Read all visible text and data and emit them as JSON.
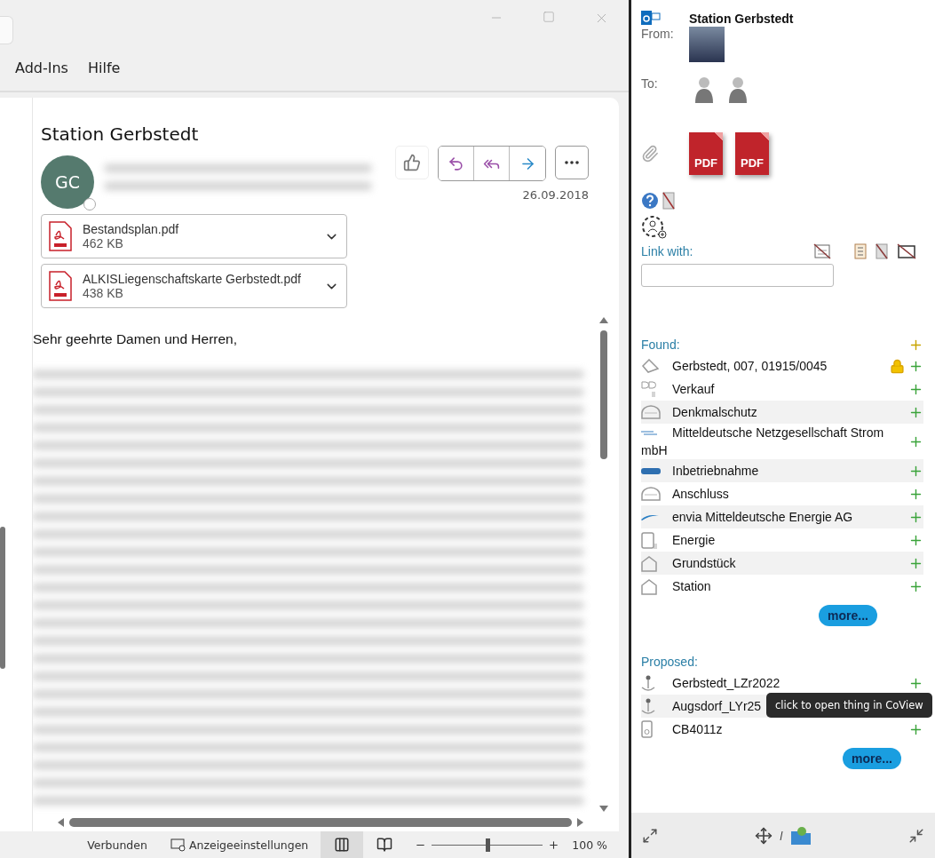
{
  "menu": [
    "Add-Ins",
    "Hilfe"
  ],
  "message": {
    "subject": "Station Gerbstedt",
    "avatar_initials": "GC",
    "date": "26.09.2018",
    "attachments": [
      {
        "name": "Bestandsplan.pdf",
        "size": "462 KB"
      },
      {
        "name": "ALKISLiegenschaftskarte Gerbstedt.pdf",
        "size": "438 KB"
      }
    ],
    "greeting": "Sehr geehrte Damen und Herren,"
  },
  "status_bar": {
    "connection": "Verbunden",
    "display_settings": "Anzeigeeinstellungen",
    "views": [
      {
        "kind": "normal",
        "selected": true
      },
      {
        "kind": "reading",
        "selected": false
      }
    ],
    "zoom": {
      "level": 0.5,
      "reading": "100 %"
    }
  },
  "panel": {
    "subject": "Station Gerbstedt",
    "from_label": "From:",
    "to_label": "To:",
    "attachment_icons": [
      "PDF",
      "PDF"
    ],
    "link_label": "Link with:",
    "found_label": "Found:",
    "found_more": "more...",
    "proposed_label": "Proposed:",
    "proposed_more": "more...",
    "found": [
      {
        "kind": "parcel",
        "label": "Gerbstedt, 007, 01915/0045",
        "locked": true,
        "shaded": false
      },
      {
        "kind": "sale",
        "label": "Verkauf",
        "locked": false,
        "shaded": false
      },
      {
        "kind": "arch",
        "label": "Denkmalschutz",
        "locked": false,
        "shaded": true
      },
      {
        "kind": "logo",
        "label": "Mitteldeutsche Netzgesellschaft Strom mbH",
        "locked": false,
        "shaded": false
      },
      {
        "kind": "tag",
        "label": "Inbetriebnahme",
        "locked": false,
        "shaded": true
      },
      {
        "kind": "arch",
        "label": "Anschluss",
        "locked": false,
        "shaded": false
      },
      {
        "kind": "swoosh",
        "label": "envia Mitteldeutsche Energie AG",
        "locked": false,
        "shaded": true
      },
      {
        "kind": "doc",
        "label": "Energie",
        "locked": false,
        "shaded": false
      },
      {
        "kind": "house",
        "label": "Grundstück",
        "locked": false,
        "shaded": true
      },
      {
        "kind": "house",
        "label": "Station",
        "locked": false,
        "shaded": false
      }
    ],
    "proposed": [
      {
        "kind": "pin",
        "label": "Gerbstedt_LZr2022",
        "locked": false,
        "shaded": false
      },
      {
        "kind": "pin",
        "label": "Augsdorf_LYr25",
        "locked": false,
        "shaded": true
      },
      {
        "kind": "device",
        "label": "CB4011z",
        "locked": false,
        "shaded": false
      }
    ],
    "tooltip": "click to open thing in CoView"
  }
}
